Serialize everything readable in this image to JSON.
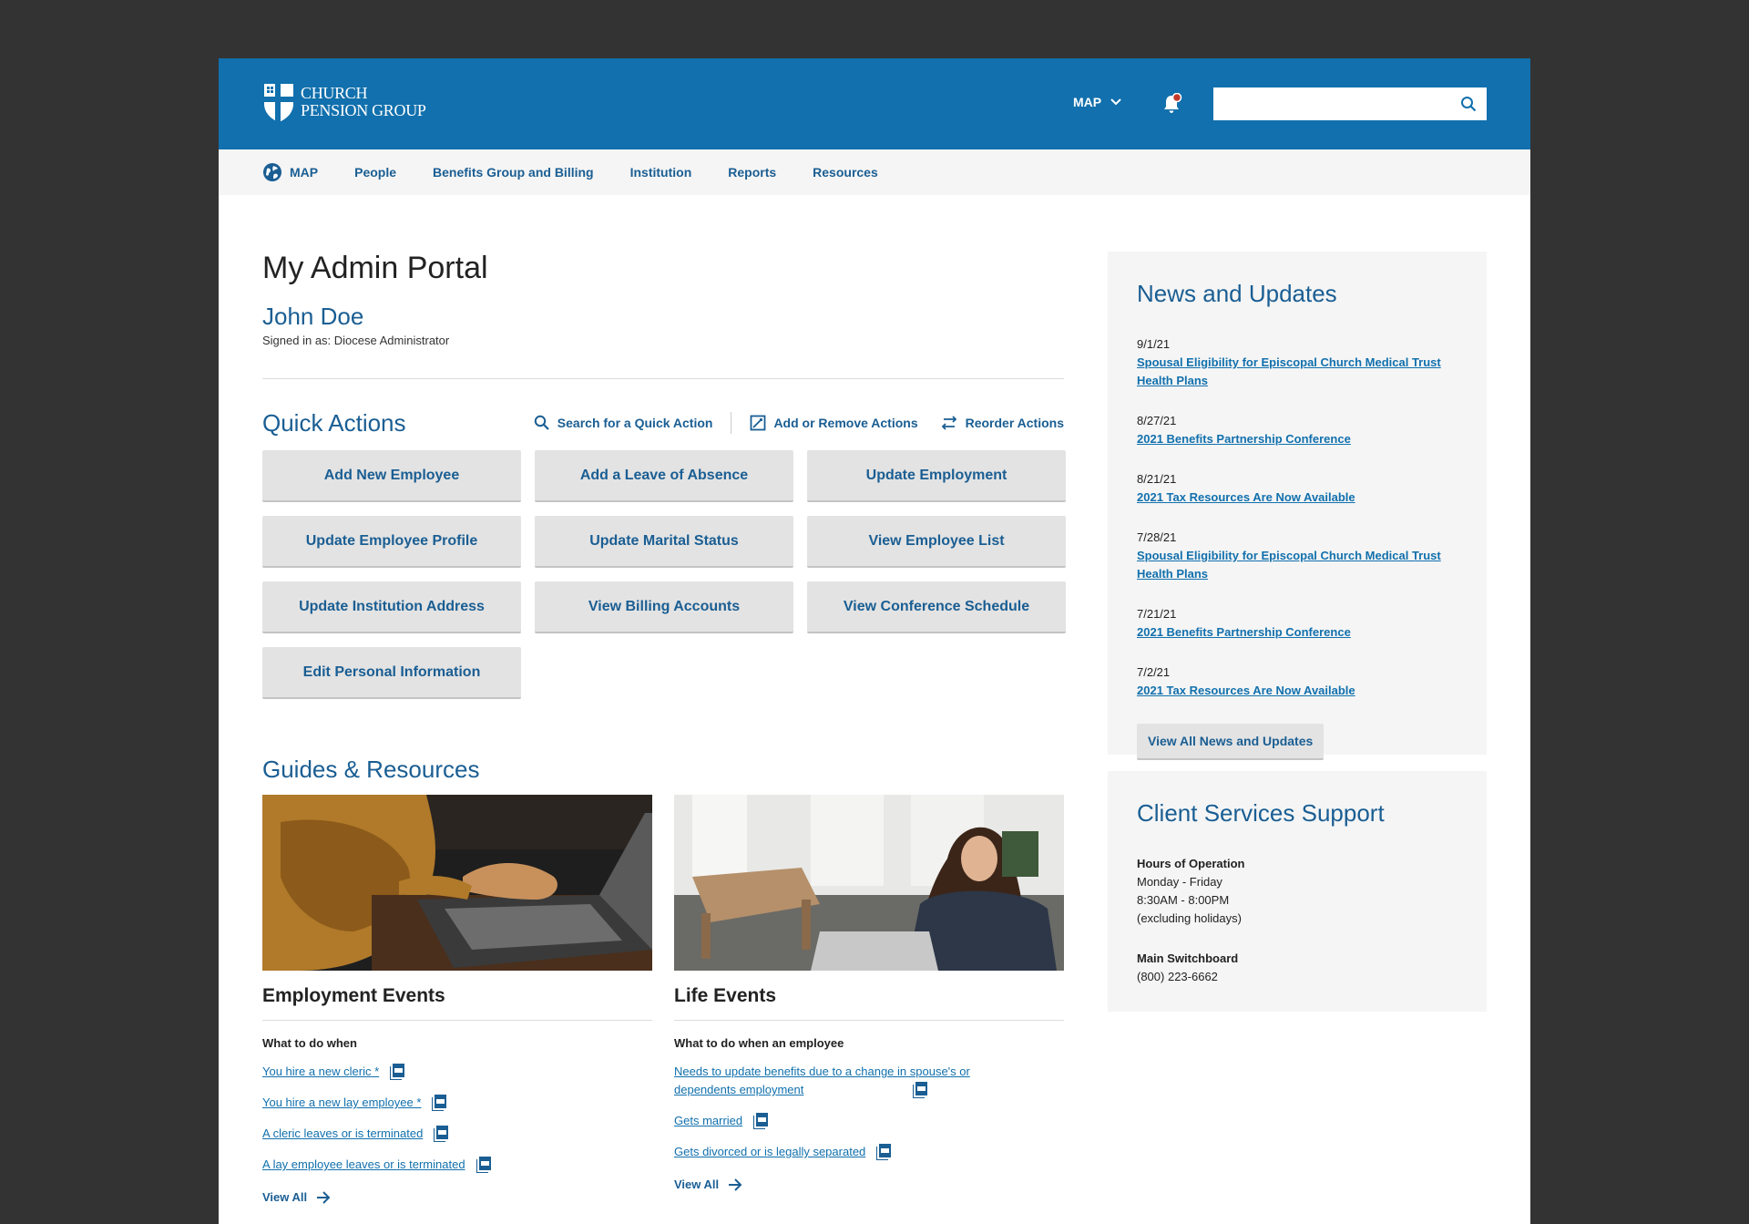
{
  "header": {
    "logo_line1": "CHURCH",
    "logo_line2": "PENSION GROUP",
    "map_menu_label": "MAP",
    "search_placeholder": ""
  },
  "nav": {
    "items": [
      {
        "label": "MAP"
      },
      {
        "label": "People"
      },
      {
        "label": "Benefits Group and Billing"
      },
      {
        "label": "Institution"
      },
      {
        "label": "Reports"
      },
      {
        "label": "Resources"
      }
    ]
  },
  "main": {
    "page_title": "My Admin Portal",
    "user_name": "John Doe",
    "signed_in": "Signed in as: Diocese Administrator"
  },
  "quick_actions": {
    "title": "Quick Actions",
    "search_label": "Search for a Quick Action",
    "edit_label": "Add or Remove Actions",
    "reorder_label": "Reorder Actions",
    "buttons": [
      "Add New Employee",
      "Add a Leave of Absence",
      "Update Employment",
      "Update Employee Profile",
      "Update Marital Status",
      "View Employee List",
      "Update Institution Address",
      "View Billing Accounts",
      "View Conference Schedule",
      "Edit Personal Information"
    ]
  },
  "guides": {
    "title": "Guides & Resources",
    "employment": {
      "title": "Employment Events",
      "subtitle": "What to do when",
      "links": [
        "You hire a new cleric *",
        "You hire a new lay employee *",
        "A cleric leaves or is terminated",
        "A lay employee leaves or is terminated"
      ],
      "view_all": "View All"
    },
    "life": {
      "title": "Life Events",
      "subtitle": "What to do when an employee",
      "links": [
        "Needs to update benefits due to a change in spouse's or dependents employment",
        "Gets married",
        "Gets divorced or is legally separated"
      ],
      "view_all": "View All"
    }
  },
  "news": {
    "title": "News and Updates",
    "items": [
      {
        "date": "9/1/21",
        "title": "Spousal Eligibility for Episcopal Church Medical Trust Health Plans"
      },
      {
        "date": "8/27/21",
        "title": "2021 Benefits Partnership Conference"
      },
      {
        "date": "8/21/21",
        "title": "2021 Tax Resources Are Now Available"
      },
      {
        "date": "7/28/21",
        "title": "Spousal Eligibility for Episcopal Church Medical Trust Health Plans"
      },
      {
        "date": "7/21/21",
        "title": "2021 Benefits Partnership Conference"
      },
      {
        "date": "7/2/21",
        "title": "2021 Tax Resources Are Now Available"
      }
    ],
    "view_all_button": "View All News and Updates"
  },
  "support": {
    "title": "Client Services Support",
    "hours_label": "Hours of Operation",
    "hours_days": "Monday - Friday",
    "hours_time": "8:30AM - 8:00PM",
    "hours_note": "(excluding holidays)",
    "switchboard_label": "Main Switchboard",
    "switchboard_phone": "(800) 223-6662"
  },
  "colors": {
    "brand_blue": "#1170ad",
    "link_dark_blue": "#1a5e93",
    "notification_red": "#c0392b"
  }
}
